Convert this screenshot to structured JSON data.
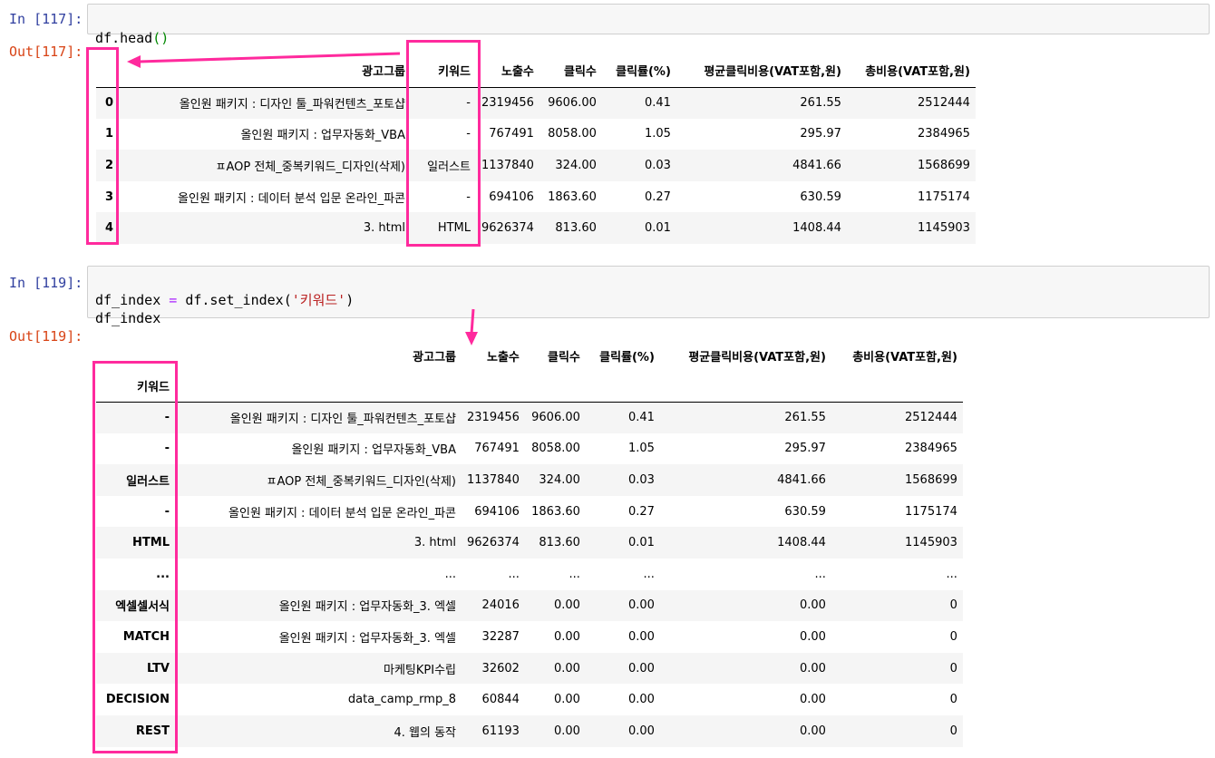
{
  "cell1": {
    "in_prompt": "In [117]:",
    "code_parts": [
      "df",
      ".",
      "head",
      "(",
      ")"
    ],
    "out_prompt": "Out[117]:"
  },
  "cell2": {
    "in_prompt": "In [119]:",
    "line1_parts": [
      "df_index",
      " = ",
      "df",
      ".set_index(",
      "'키워드'",
      ")"
    ],
    "line2": "df_index",
    "out_prompt": "Out[119]:"
  },
  "table1": {
    "columns": [
      "",
      "광고그룹",
      "키워드",
      "노출수",
      "클릭수",
      "클릭률(%)",
      "평균클릭비용(VAT포함,원)",
      "총비용(VAT포함,원)"
    ],
    "rows": [
      [
        "0",
        "올인원 패키지 : 디자인 툴_파워컨텐츠_포토샵",
        "-",
        "2319456",
        "9606.00",
        "0.41",
        "261.55",
        "2512444"
      ],
      [
        "1",
        "올인원 패키지 : 업무자동화_VBA",
        "-",
        "767491",
        "8058.00",
        "1.05",
        "295.97",
        "2384965"
      ],
      [
        "2",
        "ㅍAOP 전체_중복키워드_디자인(삭제)",
        "일러스트",
        "1137840",
        "324.00",
        "0.03",
        "4841.66",
        "1568699"
      ],
      [
        "3",
        "올인원 패키지 : 데이터 분석 입문 온라인_파콘",
        "-",
        "694106",
        "1863.60",
        "0.27",
        "630.59",
        "1175174"
      ],
      [
        "4",
        "3. html",
        "HTML",
        "9626374",
        "813.60",
        "0.01",
        "1408.44",
        "1145903"
      ]
    ]
  },
  "table2": {
    "columns": [
      "",
      "광고그룹",
      "노출수",
      "클릭수",
      "클릭률(%)",
      "평균클릭비용(VAT포함,원)",
      "총비용(VAT포함,원)"
    ],
    "index_name": "키워드",
    "rows": [
      [
        "-",
        "올인원 패키지 : 디자인 툴_파워컨텐츠_포토샵",
        "2319456",
        "9606.00",
        "0.41",
        "261.55",
        "2512444"
      ],
      [
        "-",
        "올인원 패키지 : 업무자동화_VBA",
        "767491",
        "8058.00",
        "1.05",
        "295.97",
        "2384965"
      ],
      [
        "일러스트",
        "ㅍAOP 전체_중복키워드_디자인(삭제)",
        "1137840",
        "324.00",
        "0.03",
        "4841.66",
        "1568699"
      ],
      [
        "-",
        "올인원 패키지 : 데이터 분석 입문 온라인_파콘",
        "694106",
        "1863.60",
        "0.27",
        "630.59",
        "1175174"
      ],
      [
        "HTML",
        "3. html",
        "9626374",
        "813.60",
        "0.01",
        "1408.44",
        "1145903"
      ],
      [
        "...",
        "...",
        "...",
        "...",
        "...",
        "...",
        "..."
      ],
      [
        "엑셀셀서식",
        "올인원 패키지 : 업무자동화_3. 엑셀",
        "24016",
        "0.00",
        "0.00",
        "0.00",
        "0"
      ],
      [
        "MATCH",
        "올인원 패키지 : 업무자동화_3. 엑셀",
        "32287",
        "0.00",
        "0.00",
        "0.00",
        "0"
      ],
      [
        "LTV",
        "마케팅KPI수립",
        "32602",
        "0.00",
        "0.00",
        "0.00",
        "0"
      ],
      [
        "DECISION",
        "data_camp_rmp_8",
        "60844",
        "0.00",
        "0.00",
        "0.00",
        "0"
      ],
      [
        "REST",
        "4. 웹의 동작",
        "61193",
        "0.00",
        "0.00",
        "0.00",
        "0"
      ]
    ]
  },
  "colors": {
    "highlight": "#ff2a9d",
    "in_prompt": "#303f9f",
    "out_prompt": "#d84315"
  }
}
